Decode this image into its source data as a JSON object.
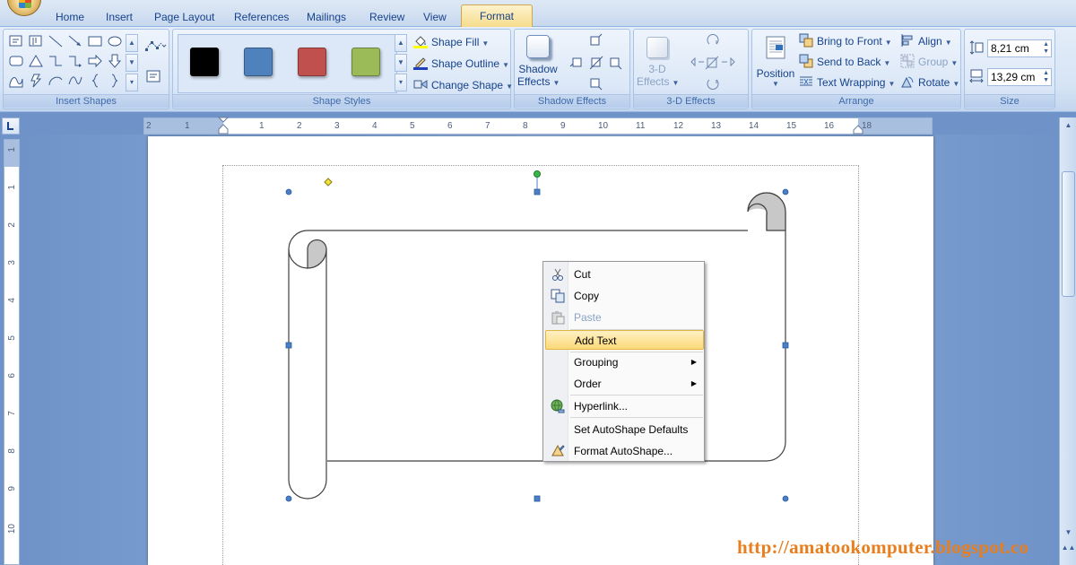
{
  "tabs": [
    {
      "label": "Home",
      "active": false
    },
    {
      "label": "Insert",
      "active": false
    },
    {
      "label": "Page Layout",
      "active": false
    },
    {
      "label": "References",
      "active": false
    },
    {
      "label": "Mailings",
      "active": false
    },
    {
      "label": "Review",
      "active": false
    },
    {
      "label": "View",
      "active": false
    },
    {
      "label": "Format",
      "active": true
    }
  ],
  "groups": {
    "insert_shapes": "Insert Shapes",
    "shape_styles": "Shape Styles",
    "shadow_effects": "Shadow Effects",
    "three_d_effects": "3-D Effects",
    "arrange": "Arrange",
    "size": "Size"
  },
  "shape_styles": {
    "swatches": [
      "#000000",
      "#4f81bd",
      "#c0504d",
      "#9bbb59"
    ],
    "shape_fill": "Shape Fill",
    "shape_outline": "Shape Outline",
    "change_shape": "Change Shape"
  },
  "shadow": {
    "line1": "Shadow",
    "line2": "Effects"
  },
  "three_d": {
    "line1": "3-D",
    "line2": "Effects"
  },
  "arrange": {
    "position": "Position",
    "bring_to_front": "Bring to Front",
    "send_to_back": "Send to Back",
    "text_wrapping": "Text Wrapping",
    "align": "Align",
    "group": "Group",
    "rotate": "Rotate"
  },
  "size": {
    "height": "8,21 cm",
    "width": "13,29 cm"
  },
  "ruler_h": [
    "2",
    "1",
    "1",
    "2",
    "3",
    "4",
    "5",
    "6",
    "7",
    "8",
    "9",
    "10",
    "11",
    "12",
    "13",
    "14",
    "15",
    "16",
    "18"
  ],
  "ruler_v": [
    "1",
    "1",
    "2",
    "3",
    "4",
    "5",
    "6",
    "7",
    "8",
    "9",
    "10"
  ],
  "context_menu": {
    "cut": "Cut",
    "copy": "Copy",
    "paste": "Paste",
    "add_text": "Add Text",
    "grouping": "Grouping",
    "order": "Order",
    "hyperlink": "Hyperlink...",
    "set_defaults": "Set AutoShape Defaults",
    "format_autoshape": "Format AutoShape..."
  },
  "watermark": "http://amatookomputer.blogspot.co"
}
